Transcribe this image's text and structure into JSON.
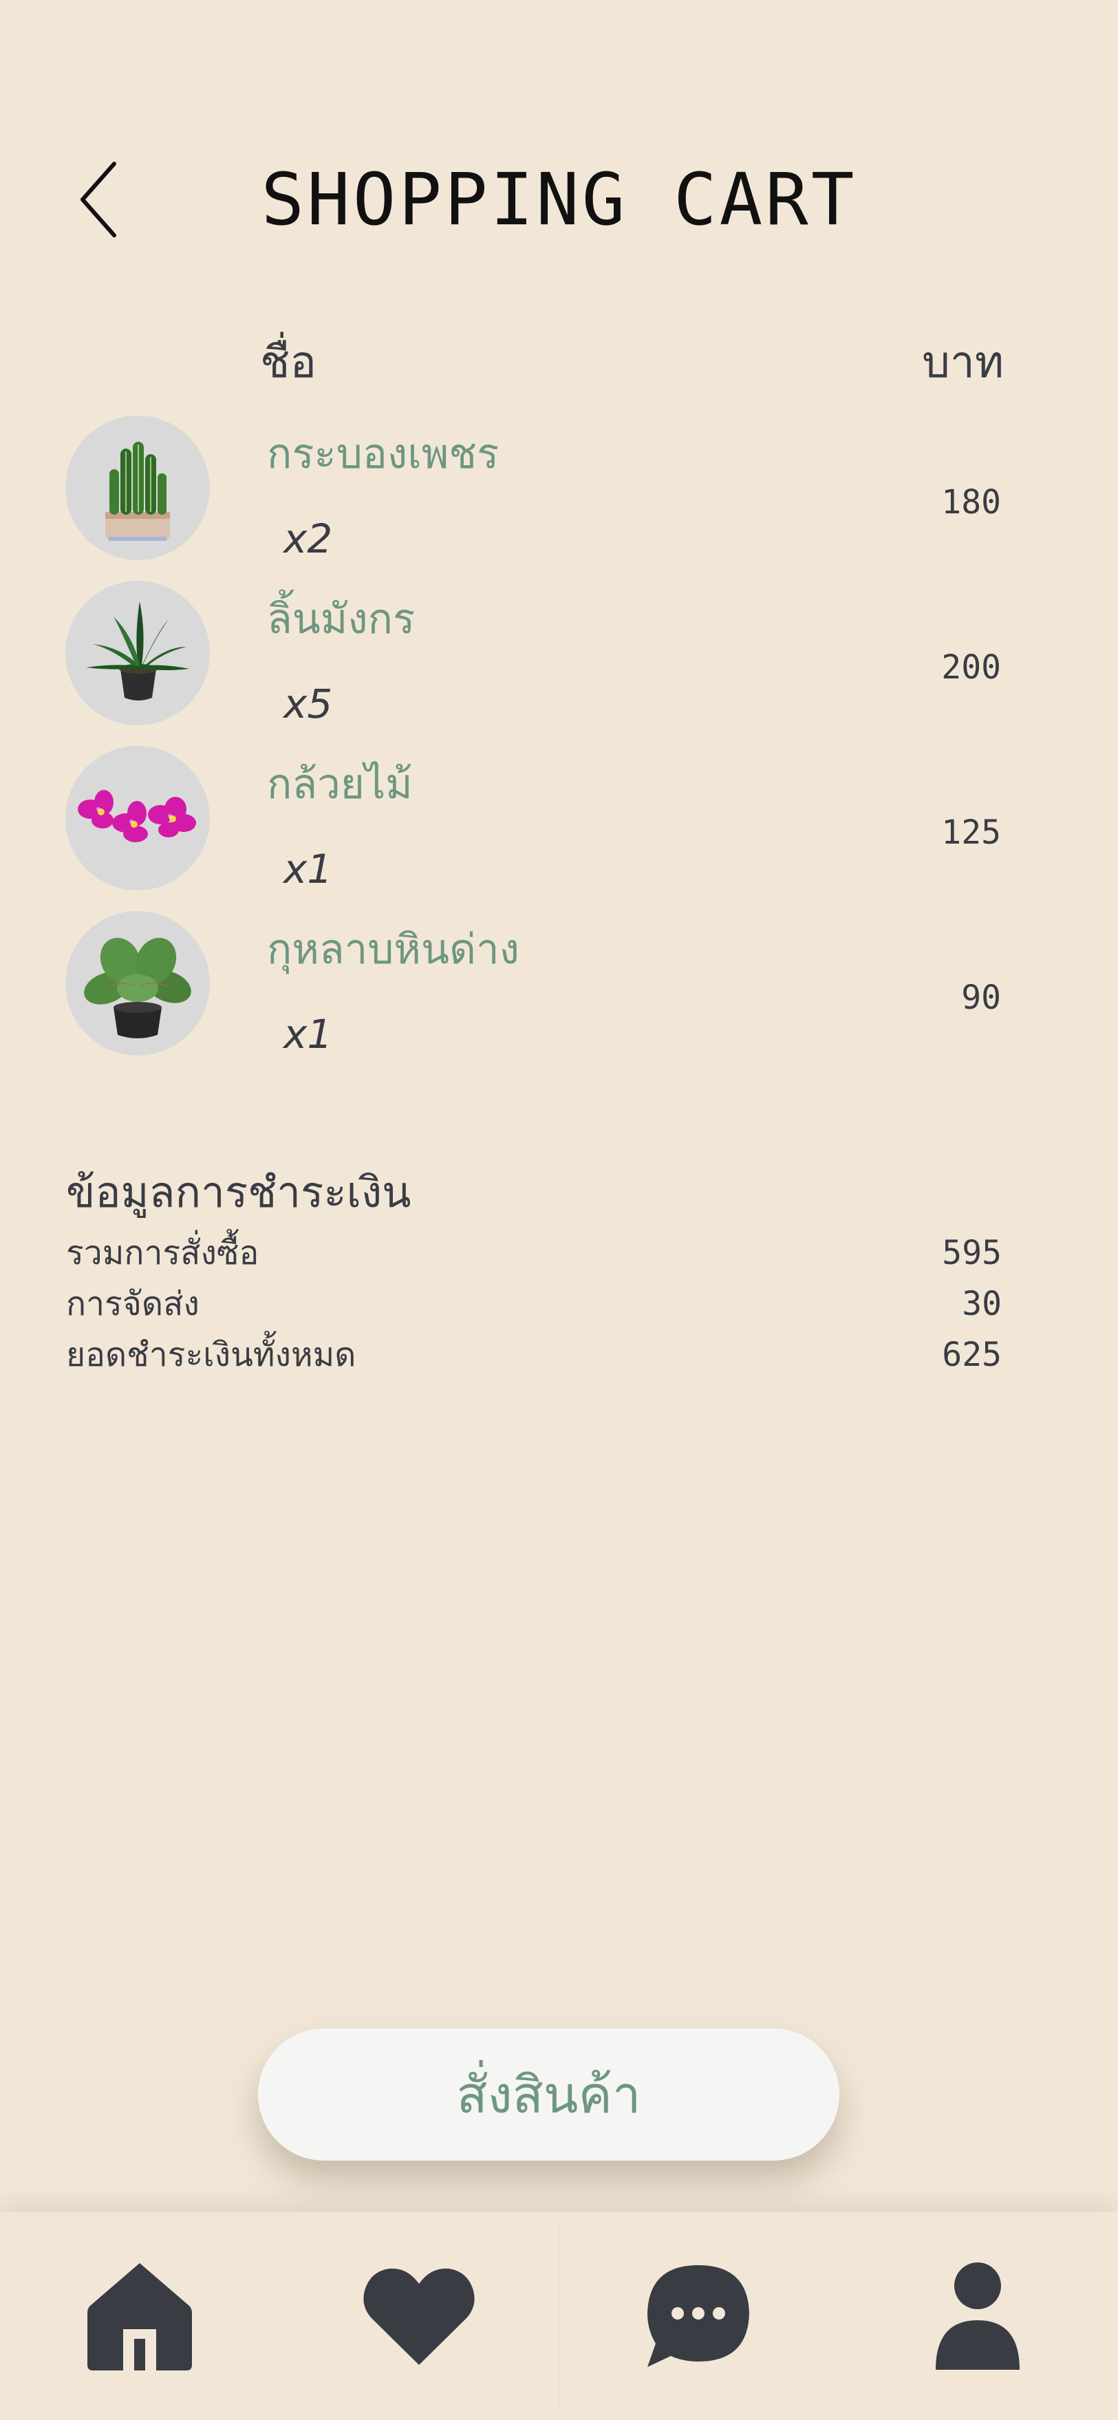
{
  "header": {
    "title": "SHOPPING CART",
    "back_icon": "chevron-left-icon"
  },
  "columns": {
    "name": "ชื่อ",
    "price": "บาท"
  },
  "cart": {
    "items": [
      {
        "name": "กระบองเพชร",
        "qty": "x2",
        "price": "180",
        "image_icon": "cactus-icon"
      },
      {
        "name": "ลิ้นมังกร",
        "qty": "x5",
        "price": "200",
        "image_icon": "snake-plant-icon"
      },
      {
        "name": "กล้วยไม้",
        "qty": "x1",
        "price": "125",
        "image_icon": "orchid-icon"
      },
      {
        "name": "กุหลาบหินด่าง",
        "qty": "x1",
        "price": "90",
        "image_icon": "succulent-icon"
      }
    ]
  },
  "payment": {
    "title": "ข้อมูลการชำระเงิน",
    "rows": [
      {
        "label": "รวมการสั่งซื้อ",
        "value": "595"
      },
      {
        "label": "การจัดส่ง",
        "value": "30"
      },
      {
        "label": "ยอดชำระเงินทั้งหมด",
        "value": "625"
      }
    ]
  },
  "order_button": {
    "label": "สั่งสินค้า"
  },
  "nav": {
    "items": [
      {
        "icon": "home-icon"
      },
      {
        "icon": "heart-icon"
      },
      {
        "icon": "chat-icon"
      },
      {
        "icon": "profile-icon"
      }
    ]
  },
  "colors": {
    "background": "#f2e7d7",
    "accent_green": "#6e9680",
    "text_dark": "#3a3c44",
    "button_bg": "#f5f5f4"
  }
}
